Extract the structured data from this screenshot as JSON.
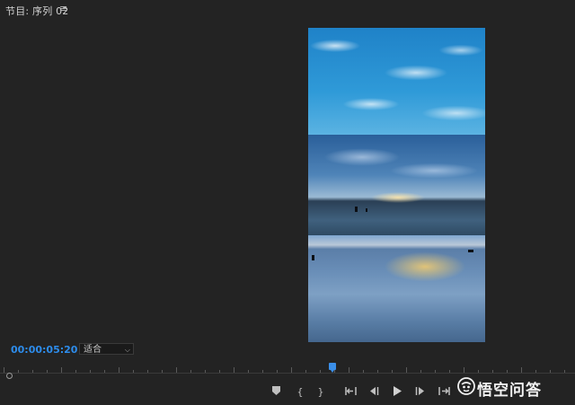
{
  "panel": {
    "title": "节目: 序列 02",
    "menu_icon": "≡"
  },
  "viewer": {
    "zoom": "适合"
  },
  "timecode": "00:00:05:20",
  "playhead_position": 0.578,
  "transport": {
    "marker": "⬤",
    "mark_in": "{",
    "mark_out": "}",
    "go_to_in": "{←",
    "step_back": "◀|",
    "play": "▶",
    "step_forward": "|▶",
    "go_to_out": "→}"
  },
  "watermark": {
    "text": "悟空问答"
  }
}
